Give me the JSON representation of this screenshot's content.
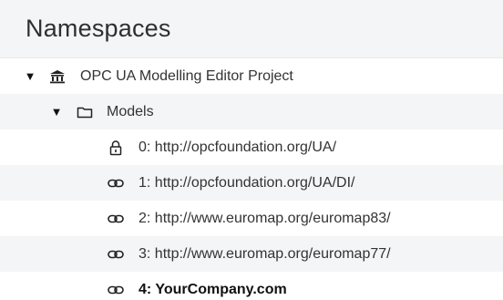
{
  "panel": {
    "title": "Namespaces"
  },
  "tree": {
    "project": {
      "label": "OPC UA Modelling Editor Project",
      "icon": "bank-icon",
      "toggle": "▼",
      "expanded": true
    },
    "models": {
      "label": "Models",
      "icon": "folder-icon",
      "toggle": "▼",
      "expanded": true
    },
    "namespaces": [
      {
        "label": "0: http://opcfoundation.org/UA/",
        "icon": "lock-icon",
        "bold": false
      },
      {
        "label": "1: http://opcfoundation.org/UA/DI/",
        "icon": "link-icon",
        "bold": false
      },
      {
        "label": "2: http://www.euromap.org/euromap83/",
        "icon": "link-icon",
        "bold": false
      },
      {
        "label": "3: http://www.euromap.org/euromap77/",
        "icon": "link-icon",
        "bold": false
      },
      {
        "label": "4: YourCompany.com",
        "icon": "link-icon",
        "bold": true
      }
    ]
  },
  "colors": {
    "header_bg": "#f4f5f6",
    "alt_row_bg": "#f4f5f6",
    "text": "#333333"
  }
}
